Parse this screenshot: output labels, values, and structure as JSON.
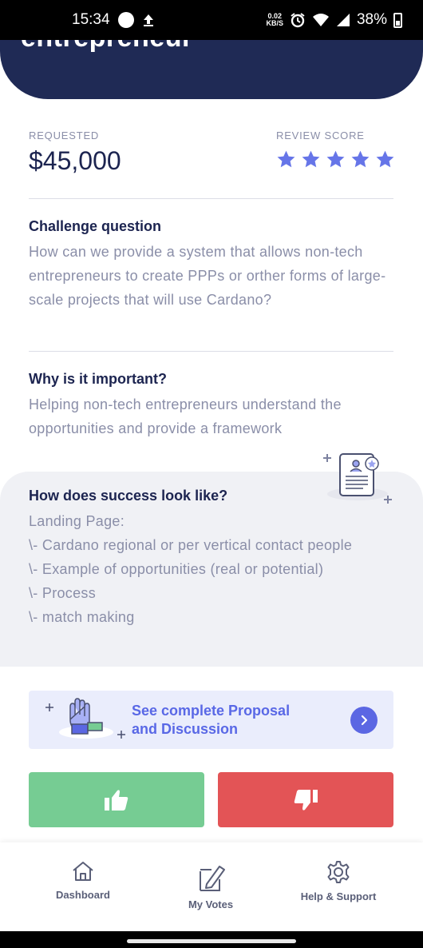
{
  "status_bar": {
    "time": "15:34",
    "net_speed_value": "0.02",
    "net_speed_unit": "KB/S",
    "battery": "38%"
  },
  "header": {
    "title_partial": "entrepreneur"
  },
  "funding": {
    "requested_label": "REQUESTED",
    "requested_amount": "$45,000",
    "review_label": "REVIEW SCORE",
    "review_score_stars": 5,
    "star_color": "#6675e8"
  },
  "challenge": {
    "title": "Challenge question",
    "body": "How can we provide a system that allows non-tech entrepreneurs to create PPPs or orther forms of large-scale projects that will use Cardano?"
  },
  "importance": {
    "title": "Why is it important?",
    "body": "Helping non-tech entrepreneurs understand the opportunities and provide a framework"
  },
  "success": {
    "title": "How does success look like?",
    "lines": [
      "Landing Page:",
      "\\- Cardano regional or per vertical contact people",
      "\\- Example of opportunities (real or potential)",
      "\\- Process",
      "\\- match making"
    ],
    "icon": "certificate-icon"
  },
  "proposal_link": {
    "line1": "See complete Proposal",
    "line2": "and Discussion",
    "icon": "chevron-right-icon"
  },
  "vote": {
    "up_icon": "thumbs-up-icon",
    "down_icon": "thumbs-down-icon",
    "up_color": "#76cc93",
    "down_color": "#e35456"
  },
  "bottom_nav": {
    "items": [
      {
        "label": "Dashboard",
        "icon": "home-icon"
      },
      {
        "label": "My Votes",
        "icon": "vote-pen-icon"
      },
      {
        "label": "Help & Support",
        "icon": "gear-icon"
      }
    ]
  }
}
